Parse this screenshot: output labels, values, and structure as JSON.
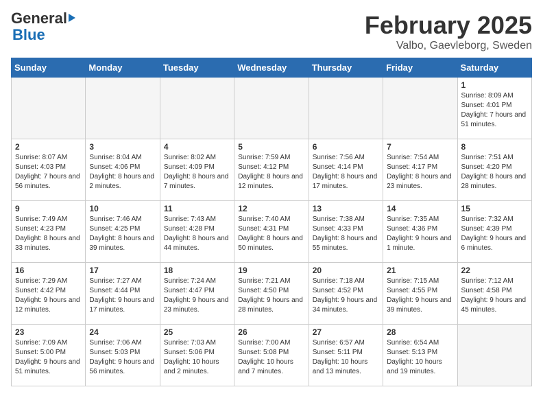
{
  "logo": {
    "general": "General",
    "blue": "Blue"
  },
  "header": {
    "month": "February 2025",
    "location": "Valbo, Gaevleborg, Sweden"
  },
  "weekdays": [
    "Sunday",
    "Monday",
    "Tuesday",
    "Wednesday",
    "Thursday",
    "Friday",
    "Saturday"
  ],
  "weeks": [
    [
      {
        "day": "",
        "info": ""
      },
      {
        "day": "",
        "info": ""
      },
      {
        "day": "",
        "info": ""
      },
      {
        "day": "",
        "info": ""
      },
      {
        "day": "",
        "info": ""
      },
      {
        "day": "",
        "info": ""
      },
      {
        "day": "1",
        "info": "Sunrise: 8:09 AM\nSunset: 4:01 PM\nDaylight: 7 hours and 51 minutes."
      }
    ],
    [
      {
        "day": "2",
        "info": "Sunrise: 8:07 AM\nSunset: 4:03 PM\nDaylight: 7 hours and 56 minutes."
      },
      {
        "day": "3",
        "info": "Sunrise: 8:04 AM\nSunset: 4:06 PM\nDaylight: 8 hours and 2 minutes."
      },
      {
        "day": "4",
        "info": "Sunrise: 8:02 AM\nSunset: 4:09 PM\nDaylight: 8 hours and 7 minutes."
      },
      {
        "day": "5",
        "info": "Sunrise: 7:59 AM\nSunset: 4:12 PM\nDaylight: 8 hours and 12 minutes."
      },
      {
        "day": "6",
        "info": "Sunrise: 7:56 AM\nSunset: 4:14 PM\nDaylight: 8 hours and 17 minutes."
      },
      {
        "day": "7",
        "info": "Sunrise: 7:54 AM\nSunset: 4:17 PM\nDaylight: 8 hours and 23 minutes."
      },
      {
        "day": "8",
        "info": "Sunrise: 7:51 AM\nSunset: 4:20 PM\nDaylight: 8 hours and 28 minutes."
      }
    ],
    [
      {
        "day": "9",
        "info": "Sunrise: 7:49 AM\nSunset: 4:23 PM\nDaylight: 8 hours and 33 minutes."
      },
      {
        "day": "10",
        "info": "Sunrise: 7:46 AM\nSunset: 4:25 PM\nDaylight: 8 hours and 39 minutes."
      },
      {
        "day": "11",
        "info": "Sunrise: 7:43 AM\nSunset: 4:28 PM\nDaylight: 8 hours and 44 minutes."
      },
      {
        "day": "12",
        "info": "Sunrise: 7:40 AM\nSunset: 4:31 PM\nDaylight: 8 hours and 50 minutes."
      },
      {
        "day": "13",
        "info": "Sunrise: 7:38 AM\nSunset: 4:33 PM\nDaylight: 8 hours and 55 minutes."
      },
      {
        "day": "14",
        "info": "Sunrise: 7:35 AM\nSunset: 4:36 PM\nDaylight: 9 hours and 1 minute."
      },
      {
        "day": "15",
        "info": "Sunrise: 7:32 AM\nSunset: 4:39 PM\nDaylight: 9 hours and 6 minutes."
      }
    ],
    [
      {
        "day": "16",
        "info": "Sunrise: 7:29 AM\nSunset: 4:42 PM\nDaylight: 9 hours and 12 minutes."
      },
      {
        "day": "17",
        "info": "Sunrise: 7:27 AM\nSunset: 4:44 PM\nDaylight: 9 hours and 17 minutes."
      },
      {
        "day": "18",
        "info": "Sunrise: 7:24 AM\nSunset: 4:47 PM\nDaylight: 9 hours and 23 minutes."
      },
      {
        "day": "19",
        "info": "Sunrise: 7:21 AM\nSunset: 4:50 PM\nDaylight: 9 hours and 28 minutes."
      },
      {
        "day": "20",
        "info": "Sunrise: 7:18 AM\nSunset: 4:52 PM\nDaylight: 9 hours and 34 minutes."
      },
      {
        "day": "21",
        "info": "Sunrise: 7:15 AM\nSunset: 4:55 PM\nDaylight: 9 hours and 39 minutes."
      },
      {
        "day": "22",
        "info": "Sunrise: 7:12 AM\nSunset: 4:58 PM\nDaylight: 9 hours and 45 minutes."
      }
    ],
    [
      {
        "day": "23",
        "info": "Sunrise: 7:09 AM\nSunset: 5:00 PM\nDaylight: 9 hours and 51 minutes."
      },
      {
        "day": "24",
        "info": "Sunrise: 7:06 AM\nSunset: 5:03 PM\nDaylight: 9 hours and 56 minutes."
      },
      {
        "day": "25",
        "info": "Sunrise: 7:03 AM\nSunset: 5:06 PM\nDaylight: 10 hours and 2 minutes."
      },
      {
        "day": "26",
        "info": "Sunrise: 7:00 AM\nSunset: 5:08 PM\nDaylight: 10 hours and 7 minutes."
      },
      {
        "day": "27",
        "info": "Sunrise: 6:57 AM\nSunset: 5:11 PM\nDaylight: 10 hours and 13 minutes."
      },
      {
        "day": "28",
        "info": "Sunrise: 6:54 AM\nSunset: 5:13 PM\nDaylight: 10 hours and 19 minutes."
      },
      {
        "day": "",
        "info": ""
      }
    ]
  ]
}
